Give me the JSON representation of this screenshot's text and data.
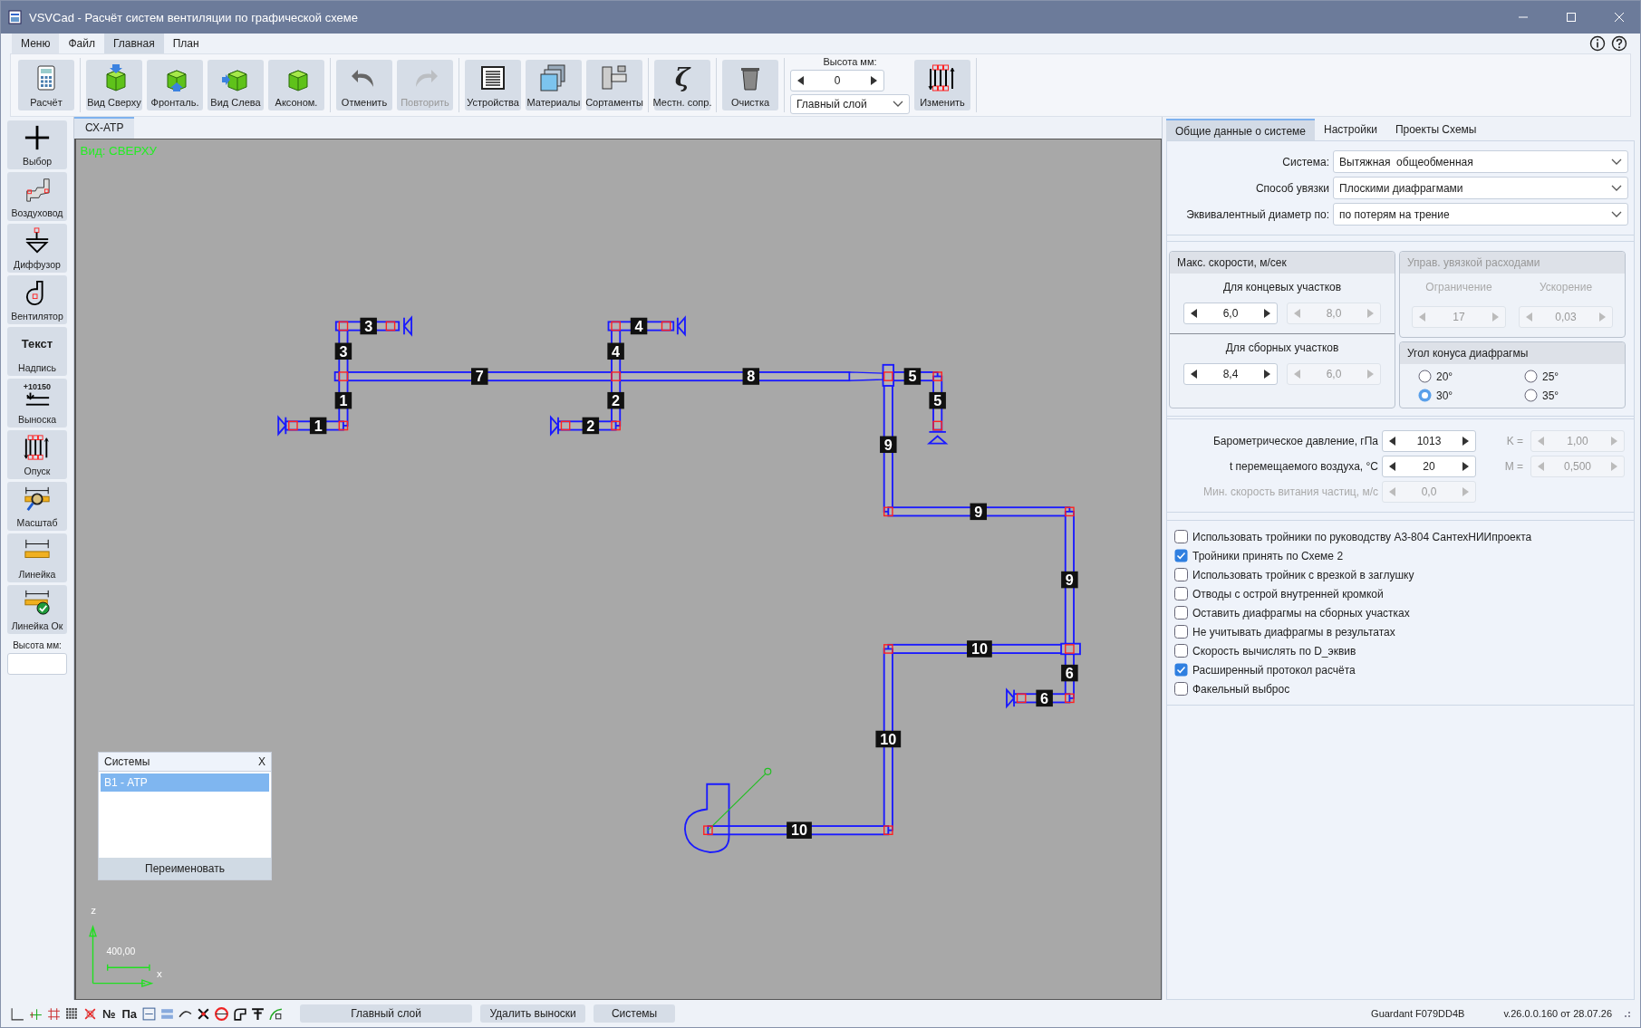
{
  "window": {
    "title": "VSVCad - Расчёт систем вентиляции по графической схеме"
  },
  "menu": [
    {
      "label": "Меню",
      "kind": "app"
    },
    {
      "label": "Файл",
      "kind": "tab",
      "selected": false
    },
    {
      "label": "Главная",
      "kind": "tab",
      "selected": true
    },
    {
      "label": "План",
      "kind": "tab",
      "selected": false
    }
  ],
  "toolbar": {
    "groups": [
      [
        {
          "label": "Расчёт",
          "disabled": false
        }
      ],
      [
        {
          "label": "Вид Сверху",
          "disabled": false
        },
        {
          "label": "Фронталь.",
          "disabled": false
        },
        {
          "label": "Вид Слева",
          "disabled": false
        },
        {
          "label": "Аксоном.",
          "disabled": false
        }
      ],
      [
        {
          "label": "Отменить",
          "disabled": false
        },
        {
          "label": "Повторить",
          "disabled": true
        }
      ],
      [
        {
          "label": "Устройства",
          "disabled": false
        },
        {
          "label": "Материалы",
          "disabled": false
        },
        {
          "label": "Сортаменты",
          "disabled": false
        }
      ],
      [
        {
          "label": "Местн. сопр.",
          "icon_text": "ζ",
          "disabled": false
        }
      ],
      [
        {
          "label": "Очистка",
          "disabled": false
        }
      ]
    ],
    "height_label": "Высота мм:",
    "height_value": "0",
    "layer": "Главный слой",
    "apply": "Изменить"
  },
  "tools": [
    {
      "label": "Выбор"
    },
    {
      "label": "Воздуховод"
    },
    {
      "label": "Диффузор"
    },
    {
      "label": "Вентилятор"
    },
    {
      "label": "Надпись",
      "icon_text": "Текст"
    },
    {
      "label": "Выноска",
      "icon_text": "+10150"
    },
    {
      "label": "Опуск"
    },
    {
      "label": "Масштаб"
    },
    {
      "label": "Линейка"
    },
    {
      "label": "Линейка Ок"
    }
  ],
  "tools_height_label": "Высота мм:",
  "canvas": {
    "tab": "СХ-АТР",
    "view_label": "Вид: СВЕРХУ",
    "section_labels": [
      "3",
      "4",
      "3",
      "4",
      "7",
      "8",
      "5",
      "1",
      "2",
      "5",
      "1",
      "2",
      "9",
      "9",
      "9",
      "10",
      "6",
      "6",
      "10",
      "10"
    ],
    "axis": {
      "z": "z",
      "scale": "400,00",
      "x": "x"
    },
    "systems_window": {
      "title": "Системы",
      "close": "X",
      "items": [
        {
          "label": "В1 - АТР",
          "selected": true
        }
      ],
      "rename": "Переименовать"
    }
  },
  "panel": {
    "tabs": [
      {
        "label": "Общие данные о системе",
        "selected": true
      },
      {
        "label": "Настройки",
        "selected": false
      },
      {
        "label": "Проекты Схемы",
        "selected": false
      }
    ],
    "fields": [
      {
        "label": "Система:",
        "value": "Вытяжная  общеобменная"
      },
      {
        "label": "Способ увязки",
        "value": "Плоскими диафрагмами"
      },
      {
        "label": "Эквивалентный диаметр по:",
        "value": "по потерям на трение"
      }
    ],
    "max_speed": {
      "title": "Макс. скорости, м/сек",
      "rows": [
        {
          "label": "Для концевых участков",
          "spinners": [
            {
              "value": "6,0",
              "disabled": false
            },
            {
              "value": "8,0",
              "disabled": true
            }
          ]
        },
        {
          "label": "Для сборных участков",
          "spinners": [
            {
              "value": "8,4",
              "disabled": false
            },
            {
              "value": "6,0",
              "disabled": true
            }
          ]
        }
      ]
    },
    "flow_control": {
      "title": "Управ. увязкой расходами",
      "disabled": true,
      "columns": [
        {
          "label": "Ограничение",
          "value": "17"
        },
        {
          "label": "Ускорение",
          "value": "0,03"
        }
      ]
    },
    "cone_angle": {
      "title": "Угол конуса диафрагмы",
      "options": [
        {
          "label": "20°",
          "selected": false
        },
        {
          "label": "25°",
          "selected": false
        },
        {
          "label": "30°",
          "selected": true
        },
        {
          "label": "35°",
          "selected": false
        }
      ]
    },
    "params": [
      {
        "label": "Барометрическое давление, гПа",
        "value": "1013",
        "disabled": false,
        "coef": {
          "label": "K =",
          "value": "1,00",
          "disabled": true
        }
      },
      {
        "label": "t перемещаемого воздуха, °C",
        "value": "20",
        "disabled": false,
        "coef": {
          "label": "M =",
          "value": "0,500",
          "disabled": true
        }
      },
      {
        "label": "Мин. скорость витания частиц, м/с",
        "value": "0,0",
        "disabled": true
      }
    ],
    "options": [
      {
        "label": "Использовать тройники по руководству А3-804 СантехНИИпроекта",
        "checked": false
      },
      {
        "label": "Тройники принять по Схеме 2",
        "checked": true
      },
      {
        "label": "Использовать тройник с врезкой в заглушку",
        "checked": false
      },
      {
        "label": "Отводы с острой внутренней кромкой",
        "checked": false
      },
      {
        "label": "Оставить диафрагмы на сборных участках",
        "checked": false
      },
      {
        "label": "Не учитывать диафрагмы в результатах",
        "checked": false
      },
      {
        "label": "Скорость вычислять по D_эквив",
        "checked": false
      },
      {
        "label": "Расширенный протокол расчёта",
        "checked": true
      },
      {
        "label": "Факельный выброс",
        "checked": false
      }
    ]
  },
  "status_bar": {
    "labels": [
      "№",
      "Па"
    ],
    "buttons": [
      "Главный слой",
      "Удалить выноски",
      "Системы"
    ],
    "license": "Guardant F079DD4B",
    "version": "v.26.0.0.160 от 28.07.26"
  }
}
